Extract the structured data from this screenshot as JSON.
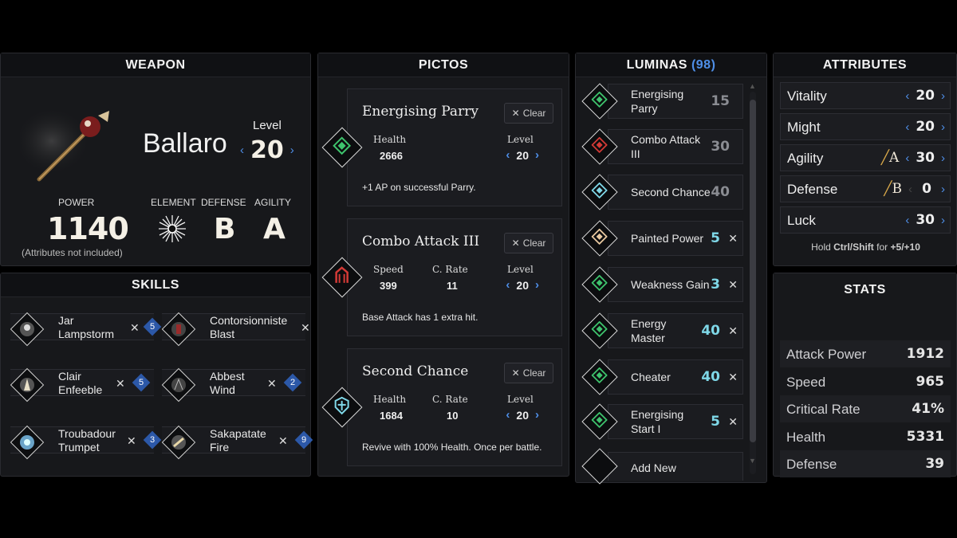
{
  "weapon": {
    "header": "WEAPON",
    "name": "Ballaro",
    "level_label": "Level",
    "level": "20",
    "power_label": "POWER",
    "power": "1140",
    "power_note": "(Attributes not included)",
    "element_label": "ELEMENT",
    "defense_label": "DEFENSE",
    "defense": "B",
    "agility_label": "AGILITY",
    "agility": "A"
  },
  "skills": {
    "header": "SKILLS",
    "items": [
      {
        "name1": "Jar",
        "name2": "Lampstorm",
        "cost": "5"
      },
      {
        "name1": "Contorsionniste",
        "name2": "Blast",
        "cost": ""
      },
      {
        "name1": "Clair",
        "name2": "Enfeeble",
        "cost": "5"
      },
      {
        "name1": "Abbest",
        "name2": "Wind",
        "cost": "2"
      },
      {
        "name1": "Troubadour",
        "name2": "Trumpet",
        "cost": "3"
      },
      {
        "name1": "Sakapatate",
        "name2": "Fire",
        "cost": "9"
      }
    ]
  },
  "pictos": {
    "header": "PICTOS",
    "clear_label": "Clear",
    "level_label": "Level",
    "cards": [
      {
        "title": "Energising Parry",
        "stat1_label": "Health",
        "stat1": "2666",
        "stat2_label": "",
        "stat2": "",
        "level": "20",
        "desc": "+1 AP on successful Parry.",
        "color": "#3ec46d"
      },
      {
        "title": "Combo Attack III",
        "stat1_label": "Speed",
        "stat1": "399",
        "stat2_label": "C. Rate",
        "stat2": "11",
        "level": "20",
        "desc": "Base Attack has 1 extra hit.",
        "color": "#d33a36"
      },
      {
        "title": "Second Chance",
        "stat1_label": "Health",
        "stat1": "1684",
        "stat2_label": "C. Rate",
        "stat2": "10",
        "level": "20",
        "desc": "Revive with 100% Health. Once per battle.",
        "color": "#7fd8e8"
      }
    ]
  },
  "luminas": {
    "header": "LUMINAS",
    "count": "(98)",
    "items": [
      {
        "name1": "Energising",
        "name2": "Parry",
        "cost": "15",
        "state": "equipped-pictos",
        "color": "#3ec46d"
      },
      {
        "name1": "Combo Attack",
        "name2": "III",
        "cost": "30",
        "state": "equipped-pictos",
        "color": "#d33a36"
      },
      {
        "name1": "Second Chance",
        "name2": "",
        "cost": "40",
        "state": "equipped-pictos",
        "color": "#7fd8e8"
      },
      {
        "name1": "Painted Power",
        "name2": "",
        "cost": "5",
        "state": "active",
        "color": "#e9c9a0"
      },
      {
        "name1": "Weakness Gain",
        "name2": "",
        "cost": "3",
        "state": "active",
        "color": "#3ec46d"
      },
      {
        "name1": "Energy",
        "name2": "Master",
        "cost": "40",
        "state": "active",
        "color": "#3ec46d"
      },
      {
        "name1": "Cheater",
        "name2": "",
        "cost": "40",
        "state": "active",
        "color": "#3ec46d"
      },
      {
        "name1": "Energising",
        "name2": "Start I",
        "cost": "5",
        "state": "active",
        "color": "#3ec46d"
      }
    ],
    "add_new": "Add New"
  },
  "attributes": {
    "header": "ATTRIBUTES",
    "items": [
      {
        "name": "Vitality",
        "value": "20",
        "grade": ""
      },
      {
        "name": "Might",
        "value": "20",
        "grade": ""
      },
      {
        "name": "Agility",
        "value": "30",
        "grade": "A"
      },
      {
        "name": "Defense",
        "value": "0",
        "grade": "B"
      },
      {
        "name": "Luck",
        "value": "30",
        "grade": ""
      }
    ],
    "hint_pre": "Hold",
    "hint_keys": "Ctrl/Shift",
    "hint_mid": "for",
    "hint_amount": "+5/+10"
  },
  "stats": {
    "header": "STATS",
    "items": [
      {
        "name": "Attack Power",
        "value": "1912"
      },
      {
        "name": "Speed",
        "value": "965"
      },
      {
        "name": "Critical Rate",
        "value": "41%"
      },
      {
        "name": "Health",
        "value": "5331"
      },
      {
        "name": "Defense",
        "value": "39"
      }
    ]
  },
  "colors": {
    "accent": "#4f8fe8",
    "lumina_cost_active": "#7fd8e8",
    "lumina_cost_dim": "#8a8c92",
    "grade_slash": "#d8a84a"
  }
}
